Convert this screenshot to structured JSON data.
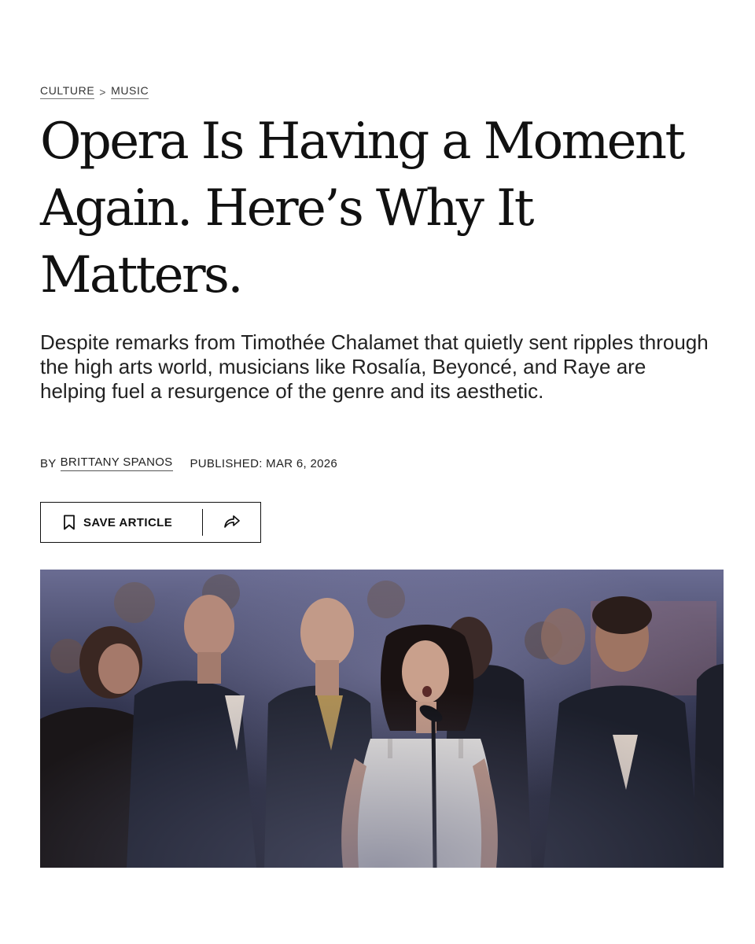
{
  "breadcrumb": {
    "section": "CULTURE",
    "separator": ">",
    "subsection": "MUSIC"
  },
  "headline": "Opera Is Having a Moment Again. Here’s Why It Matters.",
  "dek": "Despite remarks from Timothée Chalamet that quietly sent ripples through the high arts world, musicians like Rosalía, Beyoncé, and Raye are helping fuel a resurgence of the genre and its aesthetic.",
  "byline": {
    "prefix": "BY",
    "author": "BRITTANY SPANOS",
    "published": "PUBLISHED: MAR 6, 2026"
  },
  "actions": {
    "save_label": "SAVE ARTICLE",
    "save_icon": "bookmark-icon",
    "share_icon": "share-arrow-icon"
  },
  "hero_image": {
    "subject": "performer in white dress singing into a microphone in front of a choir in dark suits on a stage"
  }
}
